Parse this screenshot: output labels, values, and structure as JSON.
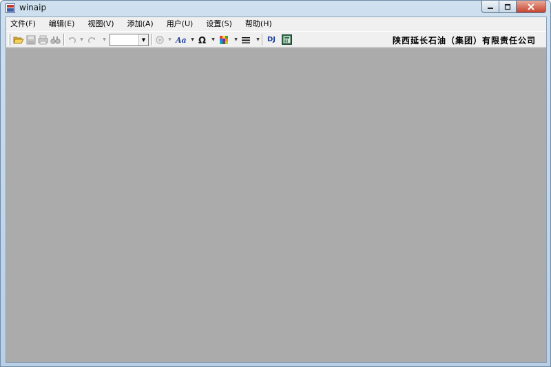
{
  "window": {
    "title": "winaip"
  },
  "menu": [
    {
      "label": "文件(F)"
    },
    {
      "label": "编辑(E)"
    },
    {
      "label": "视图(V)"
    },
    {
      "label": "添加(A)"
    },
    {
      "label": "用户(U)"
    },
    {
      "label": "设置(S)"
    },
    {
      "label": "帮助(H)"
    }
  ],
  "toolbar": {
    "company_name": "陕西延长石油（集团）有限责任公司",
    "dj_label": "DJ",
    "combo_value": "",
    "icons": [
      "open-folder-icon",
      "save-icon",
      "print-icon",
      "find-icon",
      "undo-icon",
      "redo-icon",
      "zoom-icon",
      "font-icon",
      "symbol-icon",
      "color-palette-icon",
      "line-style-icon",
      "dj-icon",
      "calculator-icon"
    ]
  },
  "colors": {
    "workspace": "#ababab",
    "chrome": "#f0f0f0",
    "accent_blue": "#1f3f9a"
  }
}
